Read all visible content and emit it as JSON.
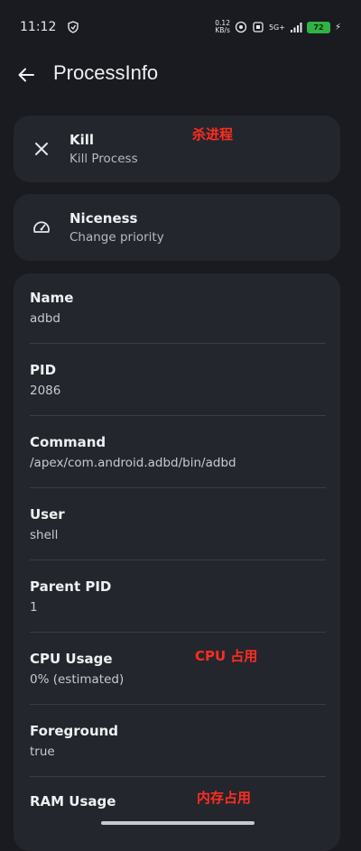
{
  "status_bar": {
    "time": "11:12",
    "net_speed_value": "0.12",
    "net_speed_unit": "KB/s",
    "network": "5G+",
    "battery": "72"
  },
  "app_bar": {
    "title": "ProcessInfo",
    "back_icon": "arrow-left-icon"
  },
  "actions": [
    {
      "title": "Kill",
      "subtitle": "Kill Process",
      "icon": "close-icon",
      "annotation": "杀进程"
    },
    {
      "title": "Niceness",
      "subtitle": "Change priority",
      "icon": "speedometer-icon"
    }
  ],
  "info": [
    {
      "label": "Name",
      "value": "adbd"
    },
    {
      "label": "PID",
      "value": "2086"
    },
    {
      "label": "Command",
      "value": "/apex/com.android.adbd/bin/adbd"
    },
    {
      "label": "User",
      "value": "shell"
    },
    {
      "label": "Parent PID",
      "value": "1"
    },
    {
      "label": "CPU Usage",
      "value": "0% (estimated)",
      "annotation": "CPU 占用"
    },
    {
      "label": "Foreground",
      "value": "true"
    },
    {
      "label": "RAM Usage",
      "value": "",
      "annotation": "内存占用"
    }
  ],
  "colors": {
    "background": "#191b20",
    "card": "#23262d",
    "annotation": "#ff2d20",
    "battery": "#2fb344"
  }
}
